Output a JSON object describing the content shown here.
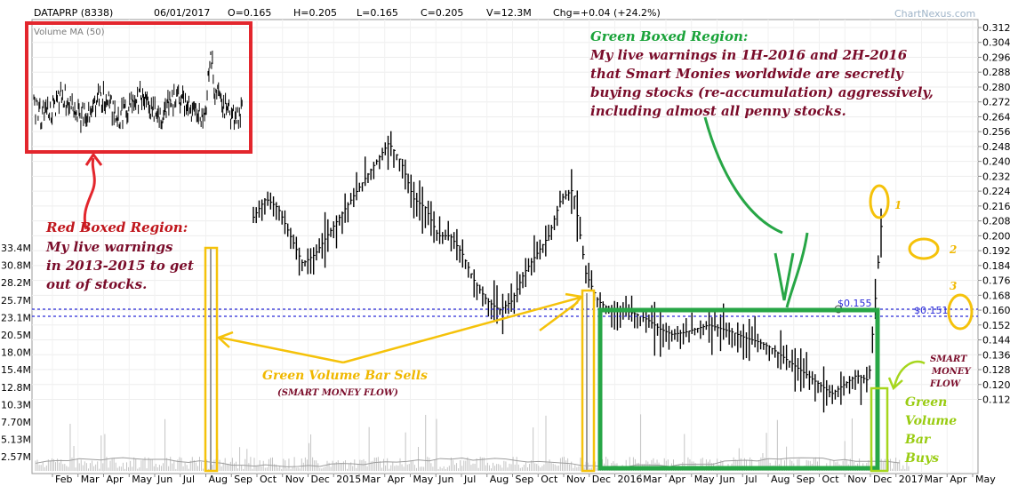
{
  "header": {
    "symbol": "DATAPRP (8338)",
    "date": "06/01/2017",
    "open": "O=0.165",
    "high": "H=0.205",
    "low": "L=0.165",
    "close": "C=0.205",
    "volume": "V=12.3M",
    "change": "Chg=+0.04 (+24.2%)",
    "brand": "ChartNexus.com"
  },
  "inset": {
    "label": "Volume MA (50)"
  },
  "annotations": {
    "red_title": "Red Boxed Region:",
    "red_lines": [
      "My live warnings",
      "in 2013-2015 to get",
      "out of stocks."
    ],
    "green_title": "Green Boxed Region:",
    "green_lines": [
      "My live warnings in 1H-2016 and 2H-2016",
      "that Smart Monies worldwide are secretly",
      "buying stocks (re-accumulation) aggressively,",
      "including almost all penny stocks."
    ],
    "sells_title": "Green Volume Bar Sells",
    "sells_sub": "(SMART MONEY FLOW)",
    "buys_lines": [
      "Green",
      "Volume",
      "Bar",
      "Buys"
    ],
    "smf_lines": [
      "SMART",
      "MONEY",
      "FLOW"
    ],
    "marker_1": "1",
    "marker_2": "2",
    "marker_3": "3"
  },
  "colors": {
    "red_box": "#e3262d",
    "green_box": "#27a646",
    "yellow": "#f5c20a",
    "lime": "#a6d61d",
    "ref_line": "#2b2bd8",
    "price": "#000000",
    "volume": "#bfbfbf"
  },
  "chart_data": {
    "type": "bar",
    "title": "DATAPRP (8338)",
    "price_axis": {
      "ylim": [
        0.104,
        0.312
      ],
      "ticks": [
        "0.312",
        "0.304",
        "0.296",
        "0.288",
        "0.280",
        "0.272",
        "0.264",
        "0.256",
        "0.248",
        "0.240",
        "0.232",
        "0.224",
        "0.216",
        "0.208",
        "0.200",
        "0.192",
        "0.184",
        "0.176",
        "0.168",
        "0.160",
        "0.152",
        "0.144",
        "0.136",
        "0.128",
        "0.120",
        "0.112"
      ]
    },
    "volume_axis": {
      "ticks": [
        "33.4M",
        "30.8M",
        "28.2M",
        "25.7M",
        "23.1M",
        "20.5M",
        "18.0M",
        "15.4M",
        "12.8M",
        "10.3M",
        "7.70M",
        "5.13M",
        "2.57M"
      ]
    },
    "x_labels": [
      "Feb",
      "Mar",
      "Apr",
      "May",
      "Jun",
      "Jul",
      "Aug",
      "Sep",
      "Oct",
      "Nov",
      "Dec",
      "2015",
      "Mar",
      "Apr",
      "May",
      "Jun",
      "Jul",
      "Aug",
      "Sep",
      "Oct",
      "Nov",
      "Dec",
      "2016",
      "Mar",
      "Apr",
      "May",
      "Jun",
      "Jul",
      "Aug",
      "Sep",
      "Oct",
      "Nov",
      "Dec",
      "2017",
      "Mar",
      "Apr",
      "May"
    ],
    "reference_lines": [
      {
        "label": "$0.155",
        "value": 0.155
      },
      {
        "label": "$0.151",
        "value": 0.151
      }
    ],
    "series": [
      {
        "type": "line",
        "values": [
          0.21,
          0.22,
          0.215,
          0.2,
          0.185,
          0.19,
          0.2,
          0.21,
          0.22,
          0.23,
          0.24,
          0.25,
          0.24,
          0.22,
          0.215,
          0.2,
          0.2,
          0.19,
          0.175,
          0.165,
          0.16,
          0.165,
          0.18,
          0.19,
          0.2,
          0.22,
          0.225,
          0.18,
          0.165,
          0.16,
          0.16,
          0.158,
          0.155,
          0.15,
          0.147,
          0.148,
          0.15,
          0.152,
          0.15,
          0.148,
          0.145,
          0.143,
          0.14,
          0.135,
          0.13,
          0.125,
          0.12,
          0.115,
          0.12,
          0.125,
          0.122,
          0.205
        ]
      }
    ]
  }
}
